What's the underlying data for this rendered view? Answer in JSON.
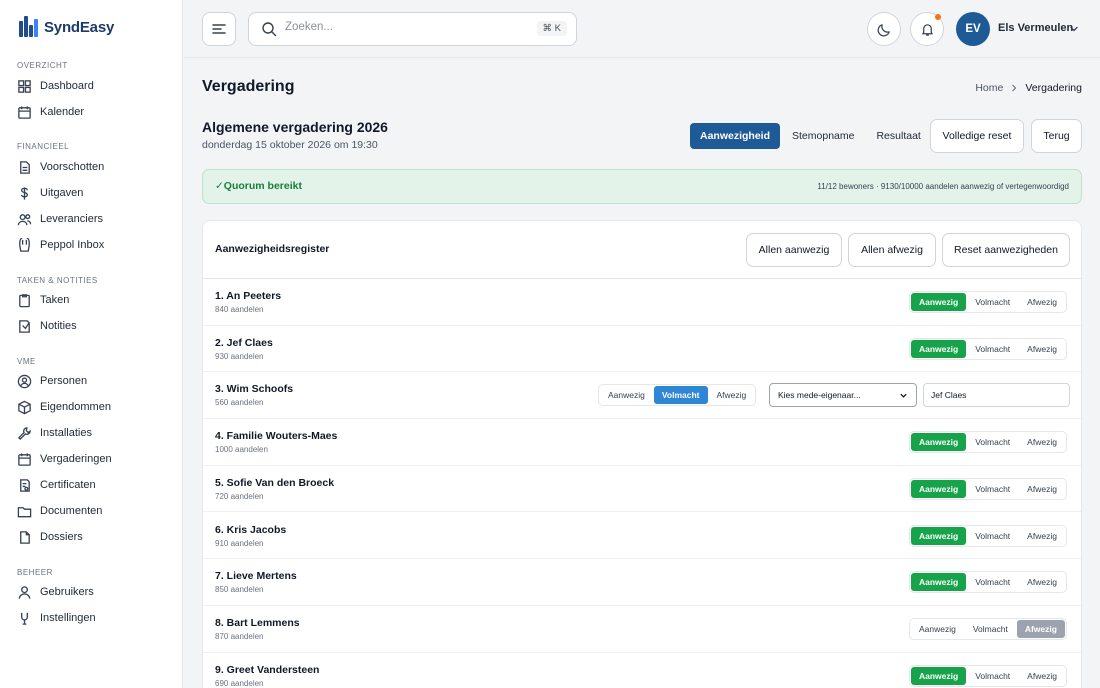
{
  "app": {
    "name": "SyndEasy"
  },
  "sidebar": {
    "sections": [
      {
        "label": "OVERZICHT",
        "items": [
          {
            "label": "Dashboard",
            "icon": "grid-icon"
          },
          {
            "label": "Kalender",
            "icon": "calendar-icon"
          }
        ]
      },
      {
        "label": "FINANCIEEL",
        "items": [
          {
            "label": "Voorschotten",
            "icon": "document-icon"
          },
          {
            "label": "Uitgaven",
            "icon": "dollar-icon"
          },
          {
            "label": "Leveranciers",
            "icon": "users-icon"
          },
          {
            "label": "Peppol Inbox",
            "icon": "inbox-icon"
          }
        ]
      },
      {
        "label": "TAKEN & NOTITIES",
        "items": [
          {
            "label": "Taken",
            "icon": "clipboard-icon"
          },
          {
            "label": "Notities",
            "icon": "note-icon"
          }
        ]
      },
      {
        "label": "VME",
        "items": [
          {
            "label": "Personen",
            "icon": "user-circle-icon"
          },
          {
            "label": "Eigendommen",
            "icon": "box-icon"
          },
          {
            "label": "Installaties",
            "icon": "wrench-icon"
          },
          {
            "label": "Vergaderingen",
            "icon": "calendar-icon"
          },
          {
            "label": "Certificaten",
            "icon": "certificate-icon"
          },
          {
            "label": "Documenten",
            "icon": "folder-icon"
          },
          {
            "label": "Dossiers",
            "icon": "file-icon"
          }
        ]
      },
      {
        "label": "BEHEER",
        "items": [
          {
            "label": "Gebruikers",
            "icon": "user-icon"
          },
          {
            "label": "Instellingen",
            "icon": "settings-icon"
          }
        ]
      }
    ]
  },
  "topbar": {
    "search_placeholder": "Zoeken...",
    "shortcut": "⌘ K",
    "avatar_initials": "EV",
    "user_name": "Els Vermeulen"
  },
  "page": {
    "title": "Vergadering",
    "breadcrumb": [
      "Home",
      "Vergadering"
    ]
  },
  "meeting": {
    "title": "Algemene vergadering 2026",
    "date": "donderdag 15 oktober 2026 om 19:30",
    "tabs": [
      "Aanwezigheid",
      "Stemopname",
      "Resultaat"
    ],
    "active_tab": "Aanwezigheid",
    "reset_label": "Volledige reset",
    "back_label": "Terug"
  },
  "quorum": {
    "label": "✓Quorum bereikt",
    "info": "11/12 bewoners · 9130/10000 aandelen aanwezig of vertegenwoordigd"
  },
  "register": {
    "title": "Aanwezigheidsregister",
    "buttons": [
      "Allen aanwezig",
      "Allen afwezig",
      "Reset aanwezigheden"
    ],
    "options": [
      "Aanwezig",
      "Volmacht",
      "Afwezig"
    ],
    "proxy_placeholder": "Kies mede-eigenaar...",
    "rows": [
      {
        "name": "1. An Peeters",
        "shares": "840 aandelen",
        "status": "Aanwezig"
      },
      {
        "name": "2. Jef Claes",
        "shares": "930 aandelen",
        "status": "Aanwezig"
      },
      {
        "name": "3. Wim Schoofs",
        "shares": "560 aandelen",
        "status": "Volmacht",
        "proxy_value": "Jef Claes"
      },
      {
        "name": "4. Familie Wouters-Maes",
        "shares": "1000 aandelen",
        "status": "Aanwezig"
      },
      {
        "name": "5. Sofie Van den Broeck",
        "shares": "720 aandelen",
        "status": "Aanwezig"
      },
      {
        "name": "6. Kris Jacobs",
        "shares": "910 aandelen",
        "status": "Aanwezig"
      },
      {
        "name": "7. Lieve Mertens",
        "shares": "850 aandelen",
        "status": "Aanwezig"
      },
      {
        "name": "8. Bart Lemmens",
        "shares": "870 aandelen",
        "status": "Afwezig"
      },
      {
        "name": "9. Greet Vandersteen",
        "shares": "690 aandelen",
        "status": "Aanwezig"
      }
    ]
  },
  "colors": {
    "brand": "#1e5a96",
    "present": "#16a34a",
    "proxy": "#2f86d4",
    "absent": "#9ca3af",
    "quorum_bg": "#e4f3ea"
  }
}
